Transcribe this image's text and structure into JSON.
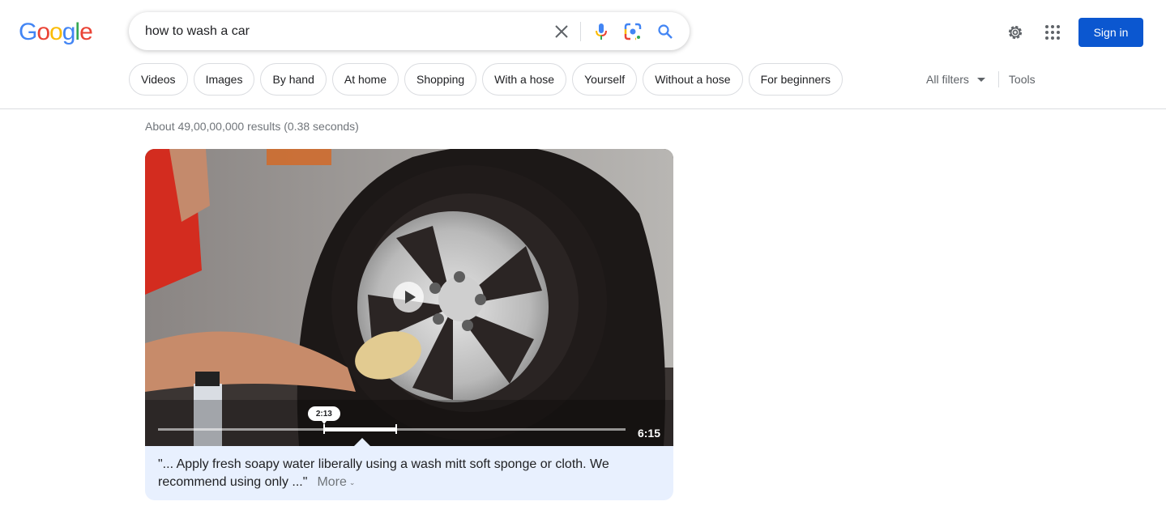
{
  "logo": {
    "letters": [
      "G",
      "o",
      "o",
      "g",
      "l",
      "e"
    ],
    "colors": [
      "#4285f4",
      "#ea4335",
      "#fbbc05",
      "#4285f4",
      "#34a853",
      "#ea4335"
    ]
  },
  "search": {
    "query": "how to wash a car",
    "clear_icon": "close-icon",
    "voice_icon": "microphone-icon",
    "lens_icon": "google-lens-icon",
    "search_icon": "search-icon"
  },
  "header": {
    "settings_icon": "gear-icon",
    "apps_icon": "apps-grid-icon",
    "signin_label": "Sign in",
    "accent": "#0b57d0"
  },
  "chips": [
    {
      "label": "Videos"
    },
    {
      "label": "Images"
    },
    {
      "label": "By hand"
    },
    {
      "label": "At home"
    },
    {
      "label": "Shopping"
    },
    {
      "label": "With a hose"
    },
    {
      "label": "Yourself"
    },
    {
      "label": "Without a hose"
    },
    {
      "label": "For beginners"
    }
  ],
  "filters": {
    "all_filters_label": "All filters",
    "tools_label": "Tools"
  },
  "results": {
    "stats": "About 49,00,00,000 results (0.38 seconds)"
  },
  "video": {
    "current_marker": "2:13",
    "duration": "6:15",
    "clip_start_fraction": 0.355,
    "clip_end_fraction": 0.51,
    "snippet": "\"... Apply fresh soapy water liberally using a wash mitt soft sponge or cloth. We recommend using only ...\"",
    "more_label": "More"
  }
}
